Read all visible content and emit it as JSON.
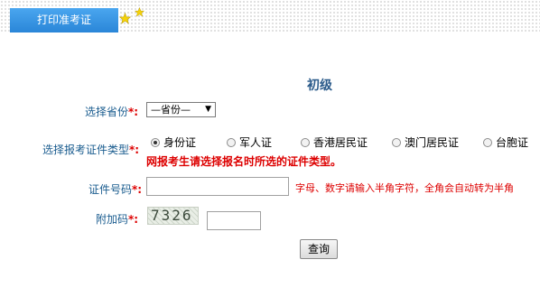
{
  "header": {
    "tab_label": "打印准考证",
    "icons": [
      "star-icon",
      "star-icon"
    ]
  },
  "level_title": "初级",
  "form": {
    "province": {
      "label": "选择省份",
      "required": "*:",
      "selected": "—省份—"
    },
    "id_type": {
      "label": "选择报考证件类型",
      "required": "*:",
      "options": [
        {
          "label": "身份证",
          "checked": true
        },
        {
          "label": "军人证",
          "checked": false
        },
        {
          "label": "香港居民证",
          "checked": false
        },
        {
          "label": "澳门居民证",
          "checked": false
        },
        {
          "label": "台胞证",
          "checked": false
        }
      ],
      "warning": "网报考生请选择报名时所选的证件类型。"
    },
    "id_number": {
      "label": "证件号码",
      "required": "*:",
      "value": "",
      "hint": "字母、数字请输入半角字符，全角会自动转为半角"
    },
    "captcha": {
      "label": "附加码",
      "required": "*:",
      "image_text": "7326",
      "value": ""
    },
    "submit_label": "查询"
  },
  "colors": {
    "tab_bg": "#2f8de0",
    "label": "#1a5c8f",
    "warning": "#dd0000"
  }
}
